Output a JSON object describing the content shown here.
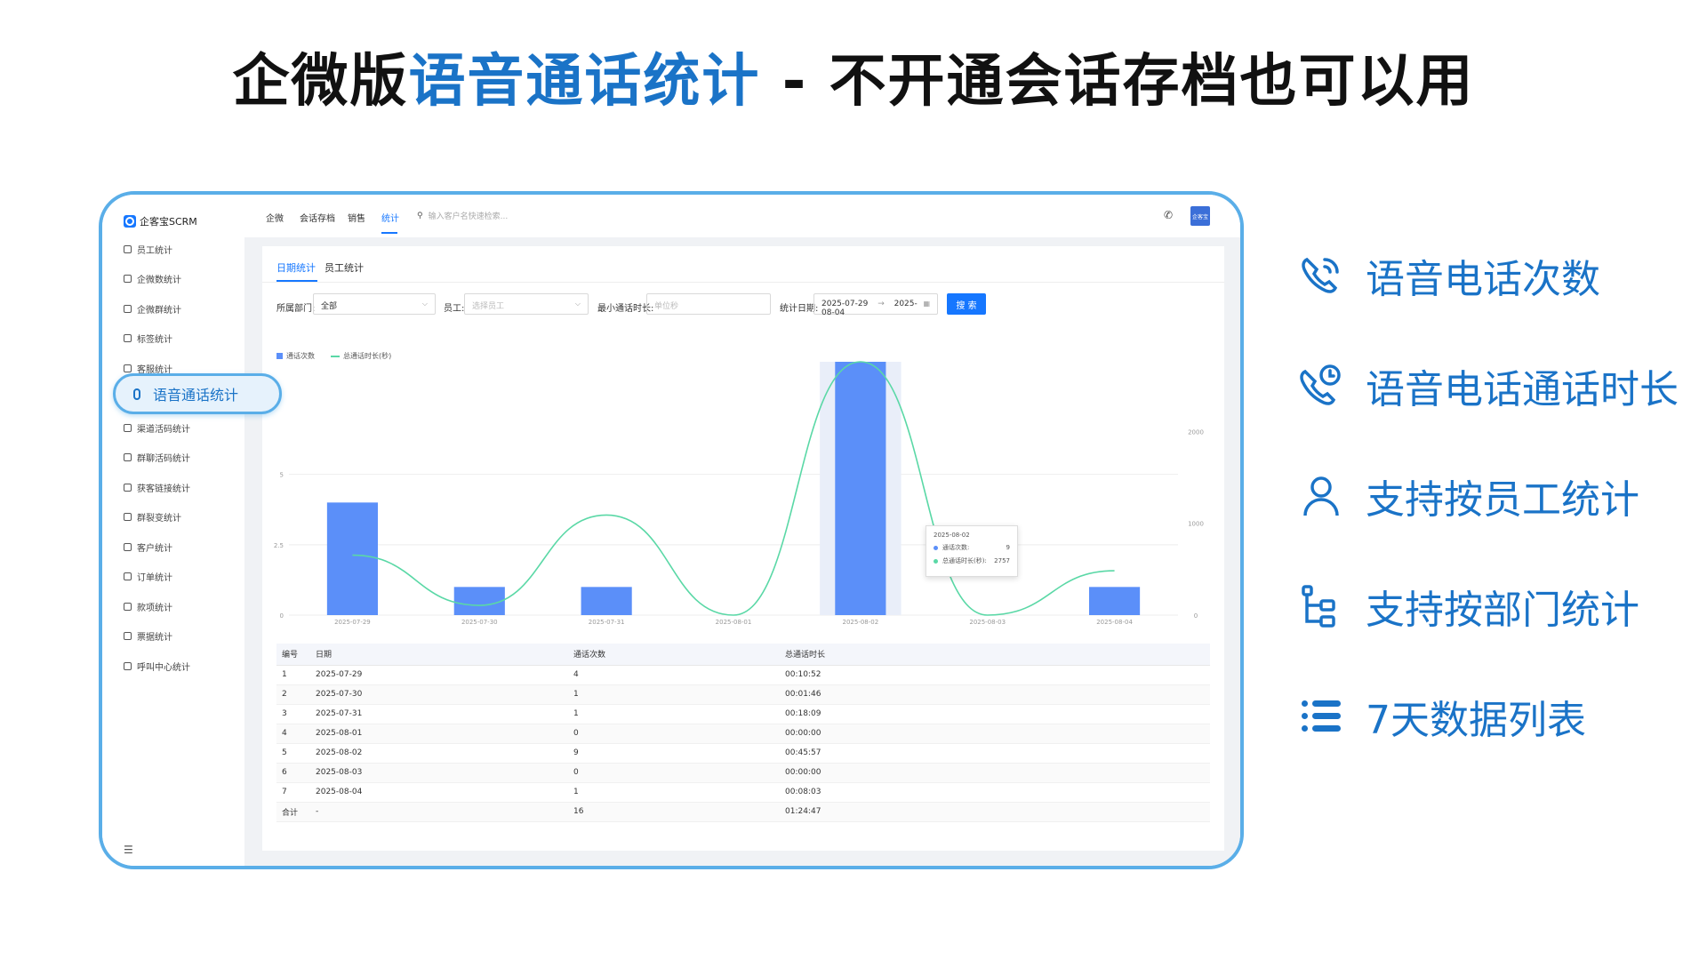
{
  "headline": {
    "part1": "企微版",
    "highlight": "语音通话统计",
    "part2": " - 不开通会话存档也可以用"
  },
  "app": {
    "logo_text": "企客宝SCRM",
    "sidebar": [
      "员工统计",
      "企微数统计",
      "企微群统计",
      "标签统计",
      "客服统计",
      "语音通话统计",
      "渠道活码统计",
      "群聊活码统计",
      "获客链接统计",
      "群裂变统计",
      "客户统计",
      "订单统计",
      "款项统计",
      "票据统计",
      "呼叫中心统计"
    ],
    "highlight_item": "语音通话统计",
    "nav": [
      "企微",
      "会话存档",
      "销售",
      "统计"
    ],
    "nav_active": "统计",
    "search_placeholder": "输入客户名快速检索...",
    "avatar_text": "企客宝",
    "tabs": [
      "日期统计",
      "员工统计"
    ],
    "filters": {
      "dept_label": "所属部门:",
      "dept_value": "全部",
      "staff_label": "员工:",
      "staff_placeholder": "选择员工",
      "min_duration_label": "最小通话时长:",
      "min_duration_placeholder": "单位秒",
      "date_label": "统计日期:",
      "date_start": "2025-07-29",
      "date_end": "2025-08-04",
      "search_button": "搜 索"
    },
    "tooltip": {
      "date": "2025-08-02",
      "count_label": "通话次数:",
      "count_value": "9",
      "duration_label": "总通话时长(秒):",
      "duration_value": "2757"
    },
    "table": {
      "headers": [
        "编号",
        "日期",
        "通话次数",
        "总通话时长"
      ],
      "rows": [
        [
          "1",
          "2025-07-29",
          "4",
          "00:10:52"
        ],
        [
          "2",
          "2025-07-30",
          "1",
          "00:01:46"
        ],
        [
          "3",
          "2025-07-31",
          "1",
          "00:18:09"
        ],
        [
          "4",
          "2025-08-01",
          "0",
          "00:00:00"
        ],
        [
          "5",
          "2025-08-02",
          "9",
          "00:45:57"
        ],
        [
          "6",
          "2025-08-03",
          "0",
          "00:00:00"
        ],
        [
          "7",
          "2025-08-04",
          "1",
          "00:08:03"
        ],
        [
          "合计",
          "-",
          "16",
          "01:24:47"
        ]
      ]
    }
  },
  "chart_data": {
    "type": "bar",
    "categories": [
      "2025-07-29",
      "2025-07-30",
      "2025-07-31",
      "2025-08-01",
      "2025-08-02",
      "2025-08-03",
      "2025-08-04"
    ],
    "series": [
      {
        "name": "通话次数",
        "type": "bar",
        "axis": "left",
        "values": [
          4,
          1,
          1,
          0,
          9,
          0,
          1
        ]
      },
      {
        "name": "总通话时长(秒)",
        "type": "line",
        "axis": "right",
        "values": [
          652,
          106,
          1089,
          0,
          2757,
          0,
          483
        ]
      }
    ],
    "y_left_ticks": [
      "0",
      "2.5",
      "5"
    ],
    "y_right_ticks": [
      "0",
      "1000",
      "2000"
    ],
    "ylim_left": [
      0,
      9
    ],
    "ylim_right": [
      0,
      2757
    ],
    "legend": "top-left",
    "bar_color": "#5b8ff9",
    "line_color": "#5ad8a6"
  },
  "features": [
    {
      "icon": "phone-wave-icon",
      "label": "语音电话次数"
    },
    {
      "icon": "phone-clock-icon",
      "label": "语音电话通话时长"
    },
    {
      "icon": "user-icon",
      "label": "支持按员工统计"
    },
    {
      "icon": "org-tree-icon",
      "label": "支持按部门统计"
    },
    {
      "icon": "list-icon",
      "label": "7天数据列表"
    }
  ],
  "colors": {
    "accent": "#1a73c7",
    "app_primary": "#1677ff",
    "card_border": "#5aaee8"
  }
}
